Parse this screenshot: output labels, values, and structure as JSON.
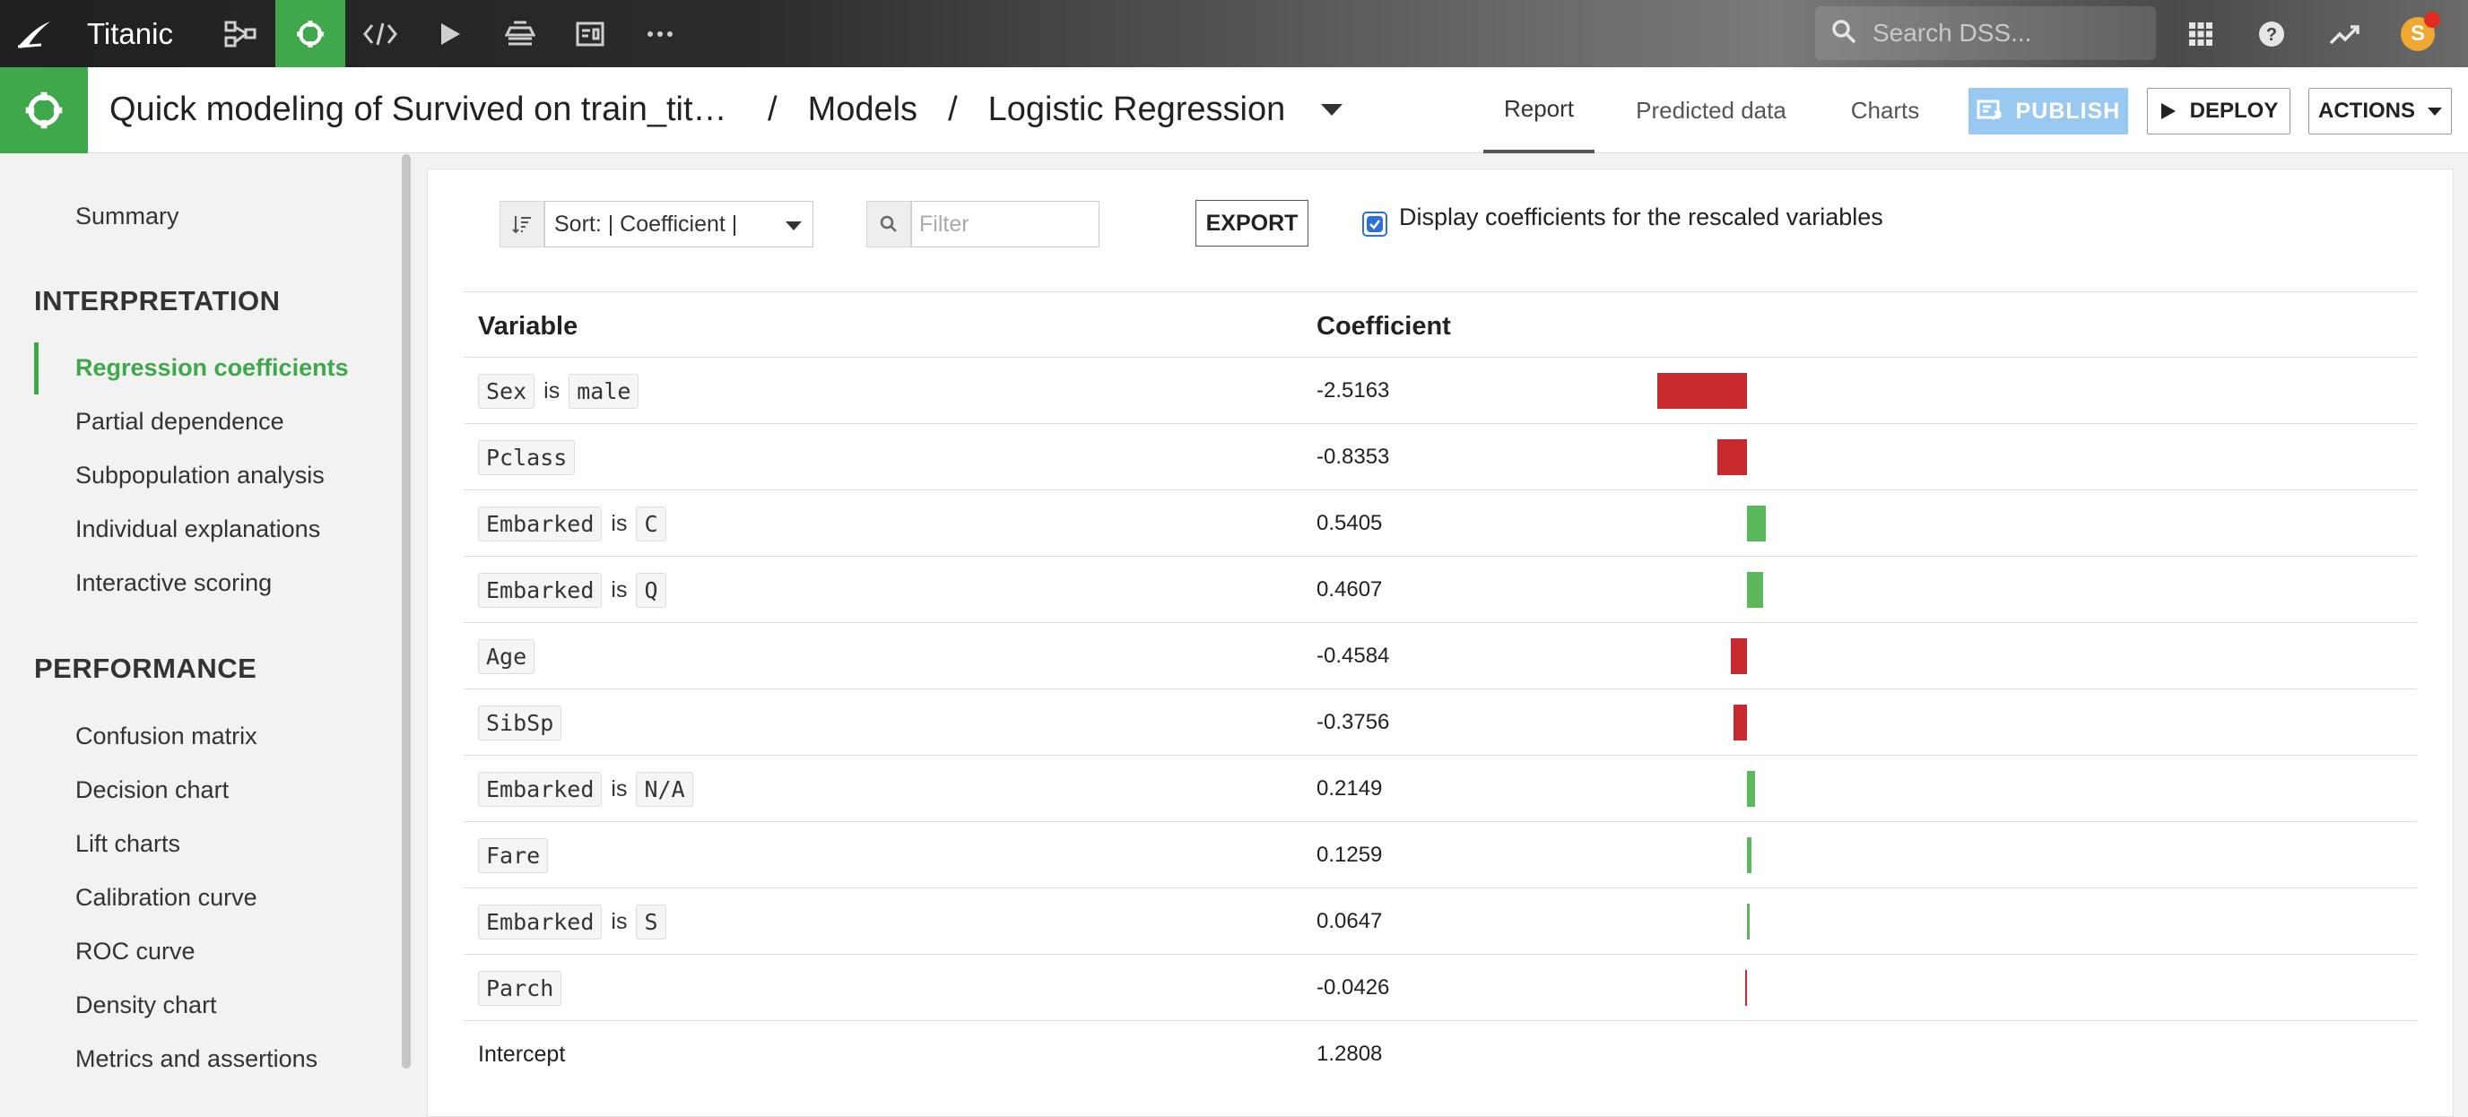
{
  "topbar": {
    "project_name": "Titanic",
    "nav_icons": [
      "flow-icon",
      "lab-icon",
      "code-icon",
      "run-icon",
      "deploy-icon",
      "dashboard-icon",
      "more-icon"
    ],
    "search_placeholder": "Search DSS...",
    "avatar_letter": "S"
  },
  "header": {
    "title": "Quick modeling of Survived on train_tita…",
    "crumb_sep": "/",
    "crumb_models": "Models",
    "crumb_model": "Logistic Regression",
    "tabs": [
      {
        "label": "Report",
        "active": true
      },
      {
        "label": "Predicted data",
        "active": false
      },
      {
        "label": "Charts",
        "active": false
      }
    ],
    "publish_label": "PUBLISH",
    "deploy_label": "DEPLOY",
    "actions_label": "ACTIONS"
  },
  "sidebar": {
    "summary": "Summary",
    "interpretation_title": "INTERPRETATION",
    "interpretation_items": [
      "Regression coefficients",
      "Partial dependence",
      "Subpopulation analysis",
      "Individual explanations",
      "Interactive scoring"
    ],
    "performance_title": "PERFORMANCE",
    "performance_items": [
      "Confusion matrix",
      "Decision chart",
      "Lift charts",
      "Calibration curve",
      "ROC curve",
      "Density chart",
      "Metrics and assertions"
    ]
  },
  "toolbar": {
    "sort_label": "Sort: | Coefficient |",
    "filter_placeholder": "Filter",
    "export_label": "EXPORT",
    "rescaled_label": "Display coefficients for the rescaled variables",
    "rescaled_checked": true
  },
  "table": {
    "col_variable": "Variable",
    "col_coefficient": "Coefficient",
    "is_word": "is",
    "rows": [
      {
        "variable": "Sex",
        "value": "male",
        "coefficient": "-2.5163",
        "coef": -2.5163
      },
      {
        "variable": "Pclass",
        "value": null,
        "coefficient": "-0.8353",
        "coef": -0.8353
      },
      {
        "variable": "Embarked",
        "value": "C",
        "coefficient": "0.5405",
        "coef": 0.5405
      },
      {
        "variable": "Embarked",
        "value": "Q",
        "coefficient": "0.4607",
        "coef": 0.4607
      },
      {
        "variable": "Age",
        "value": null,
        "coefficient": "-0.4584",
        "coef": -0.4584
      },
      {
        "variable": "SibSp",
        "value": null,
        "coefficient": "-0.3756",
        "coef": -0.3756
      },
      {
        "variable": "Embarked",
        "value": "N/A",
        "coefficient": "0.2149",
        "coef": 0.2149
      },
      {
        "variable": "Fare",
        "value": null,
        "coefficient": "0.1259",
        "coef": 0.1259
      },
      {
        "variable": "Embarked",
        "value": "S",
        "coefficient": "0.0647",
        "coef": 0.0647
      },
      {
        "variable": "Parch",
        "value": null,
        "coefficient": "-0.0426",
        "coef": -0.0426
      }
    ],
    "intercept_label": "Intercept",
    "intercept_value": "1.2808"
  },
  "colors": {
    "accent": "#3ea84a",
    "negative": "#c8292e",
    "positive": "#5cb85c",
    "publish": "#99c8f0"
  }
}
